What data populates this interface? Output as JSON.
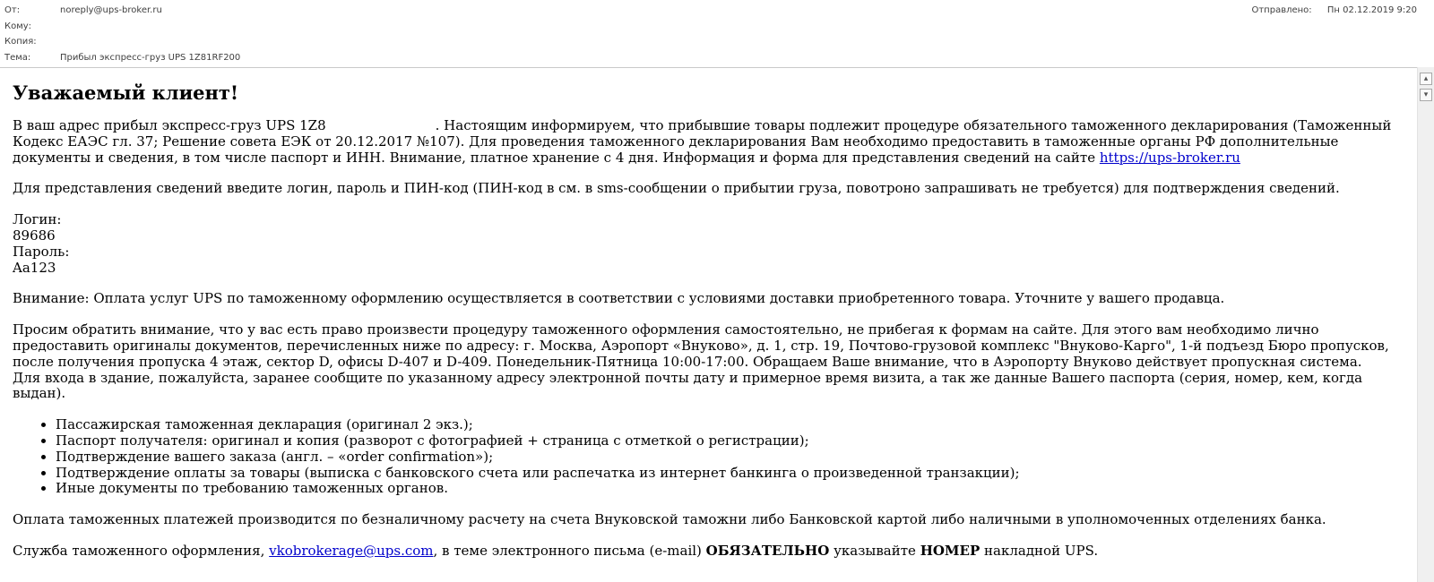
{
  "header": {
    "from_label": "От:",
    "from_value": "noreply@ups-broker.ru",
    "to_label": "Кому:",
    "to_value": "",
    "cc_label": "Копия:",
    "cc_value": "",
    "subject_label": "Тема:",
    "subject_value": "Прибыл экспресс-груз UPS 1Z81RF200",
    "sent_label": "Отправлено:",
    "sent_value": "Пн 02.12.2019 9:20"
  },
  "body": {
    "greeting": "Уважаемый клиент!",
    "p1_a": "В ваш адрес прибыл экспресс-груз UPS 1Z8",
    "p1_b": ". Настоящим информируем, что прибывшие товары подлежит процедуре обязательного таможенного декларирования (Таможенный Кодекс ЕАЭС гл. 37; Решение совета ЕЭК от 20.12.2017 №107). Для проведения таможенного декларирования Вам необходимо предоставить в таможенные органы РФ дополнительные документы и сведения, в том числе паспорт и ИНН. Внимание, платное хранение с 4 дня. Информация и форма для представления сведений на сайте",
    "p1_link": "https://ups-broker.ru",
    "p2": "Для представления сведений введите логин, пароль и ПИН-код (ПИН-код в см. в sms-сообщении о прибытии груза, повотроно запрашивать не требуется) для подтверждения сведений.",
    "login_label": "Логин:",
    "login_value": "89686",
    "password_label": "Пароль:",
    "password_value": "Aa123",
    "p3": "Внимание: Оплата услуг UPS по таможенному оформлению осуществляется в соответствии с условиями доставки приобретенного товара. Уточните у вашего продавца.",
    "p4": "Просим обратить внимание, что у вас есть право произвести процедуру таможенного оформления самостоятельно, не прибегая к формам на сайте. Для этого вам необходимо лично предоставить оригиналы документов, перечисленных ниже по адресу: г. Москва, Аэропорт «Внуково», д. 1, стр. 19, Почтово-грузовой комплекс \"Внуково-Карго\", 1-й подъезд Бюро пропусков, после получения пропуска 4 этаж, сектор D, офисы D-407 и D-409. Понедельник-Пятница 10:00-17:00. Обращаем Ваше внимание, что в Аэропорту Внуково действует пропускная система. Для входа в здание, пожалуйста, заранее сообщите по указанному адресу электронной почты дату и примерное время визита, а так же данные Вашего паспорта (серия, номер, кем, когда выдан).",
    "list": [
      "Пассажирская таможенная декларация (оригинал 2 экз.);",
      "Паспорт получателя: оригинал и копия (разворот с фотографией + страница с отметкой о регистрации);",
      "Подтверждение вашего заказа (англ. – «order confirmation»);",
      "Подтверждение оплаты за товары (выписка с банковского счета или распечатка из интернет банкинга о произведенной транзакции);",
      "Иные документы по требованию таможенных органов."
    ],
    "p5": "Оплата таможенных платежей производится по безналичному расчету на счета Внуковской таможни либо Банковской картой либо наличными в уполномоченных отделениях банка.",
    "p6_a": "Служба таможенного оформления,",
    "p6_link": "vkobrokerage@ups.com",
    "p6_b": ", в теме электронного письма (e-mail)",
    "p6_bold1": "ОБЯЗАТЕЛЬНО",
    "p6_c": "указывайте",
    "p6_bold2": "НОМЕР",
    "p6_d": "накладной UPS."
  },
  "scrollbar": {
    "up_icon": "scroll-up-arrow"
  }
}
